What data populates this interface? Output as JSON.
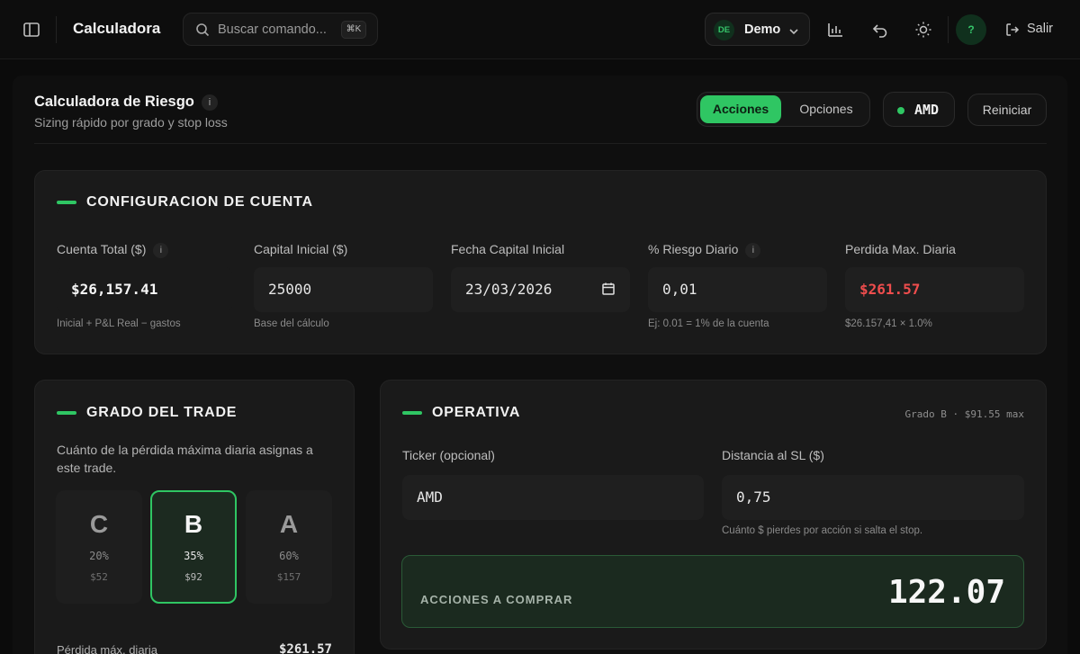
{
  "topbar": {
    "app_title": "Calculadora",
    "search_placeholder": "Buscar comando...",
    "search_shortcut": "⌘K",
    "account": {
      "initials": "DE",
      "name": "Demo"
    },
    "help_label": "?",
    "logout_label": "Salir",
    "icons": [
      "sidebar-icon",
      "chart-icon",
      "undo-icon",
      "sun-icon",
      "logout-icon"
    ]
  },
  "header": {
    "title": "Calculadora de Riesgo",
    "info": "i",
    "subtitle": "Sizing rápido por grado y stop loss",
    "mode_tabs": [
      {
        "label": "Acciones",
        "active": true
      },
      {
        "label": "Opciones",
        "active": false
      }
    ],
    "ticker": "AMD",
    "reset_label": "Reiniciar"
  },
  "account_config": {
    "title": "CONFIGURACION DE CUENTA",
    "fields": [
      {
        "label": "Cuenta Total ($)",
        "info": "i",
        "value": "$26,157.41",
        "hint": "Inicial + P&L Real − gastos"
      },
      {
        "label": "Capital Inicial ($)",
        "value": "25000",
        "hint": "Base del cálculo"
      },
      {
        "label": "Fecha Capital Inicial",
        "value": "23/03/2026"
      },
      {
        "label": "% Riesgo Diario",
        "info": "i",
        "value": "0,01",
        "hint": "Ej: 0.01 = 1% de la cuenta"
      },
      {
        "label": "Perdida Max. Diaria",
        "value": "$261.57",
        "hint": "$26.157,41 × 1.0%"
      }
    ]
  },
  "grade": {
    "title": "GRADO DEL TRADE",
    "description": "Cuánto de la pérdida máxima diaria asignas a este trade.",
    "options": [
      {
        "letter": "C",
        "pct": "20%",
        "amount": "$52",
        "selected": false
      },
      {
        "letter": "B",
        "pct": "35%",
        "amount": "$92",
        "selected": true
      },
      {
        "letter": "A",
        "pct": "60%",
        "amount": "$157",
        "selected": false
      }
    ],
    "footer_label": "Pérdida máx. diaria",
    "footer_value": "$261.57"
  },
  "operativa": {
    "title": "OPERATIVA",
    "meta": "Grado B · $91.55 max",
    "ticker_label": "Ticker (opcional)",
    "ticker_value": "AMD",
    "sl_label": "Distancia al SL ($)",
    "sl_value": "0,75",
    "sl_hint": "Cuánto $ pierdes por acción si salta el stop.",
    "result_label": "ACCIONES A COMPRAR",
    "result_value": "122.07"
  },
  "colors": {
    "accent": "#2fc663",
    "loss": "#ef4d4d",
    "background": "#0b0b0b",
    "card": "#1a1a1a"
  }
}
